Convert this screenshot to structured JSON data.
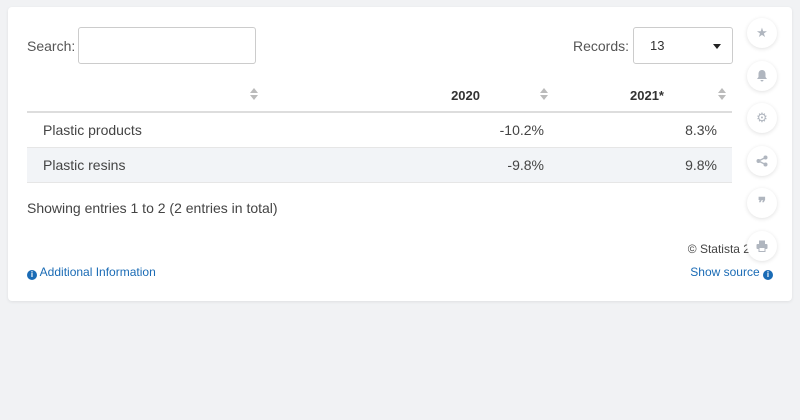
{
  "search": {
    "label": "Search:",
    "value": ""
  },
  "records": {
    "label": "Records:",
    "value": "13"
  },
  "table": {
    "headers": [
      "",
      "2020",
      "2021*"
    ],
    "rows": [
      {
        "name": "Plastic products",
        "v2020": "-10.2%",
        "v2021": "8.3%"
      },
      {
        "name": "Plastic resins",
        "v2020": "-9.8%",
        "v2021": "9.8%"
      }
    ]
  },
  "footer": {
    "showing": "Showing entries 1 to 2 (2 entries in total)",
    "credit": "© Statista 2021",
    "additional_info": "Additional Information",
    "show_source": "Show source"
  },
  "side_icons": [
    "star-icon",
    "bell-icon",
    "gear-icon",
    "share-icon",
    "quote-icon",
    "print-icon"
  ],
  "colors": {
    "link": "#1a6bb5",
    "row_alt": "#f2f4f7",
    "background": "#f1f2f4"
  }
}
